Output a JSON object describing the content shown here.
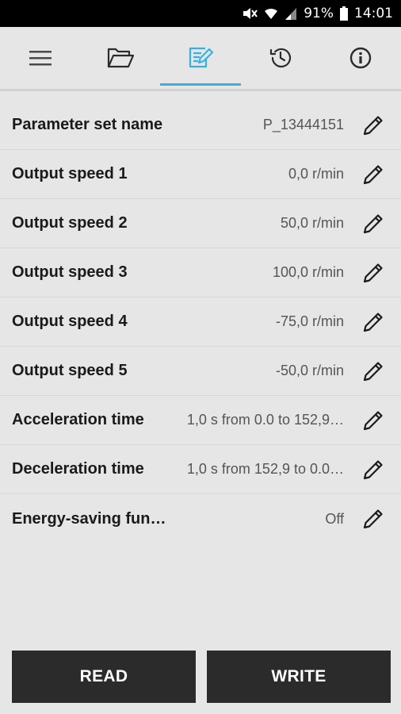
{
  "status_bar": {
    "battery_percent": "91%",
    "time": "14:01",
    "icons": [
      "mute-icon",
      "wifi-icon",
      "signal-icon",
      "battery-icon"
    ]
  },
  "tabs": [
    {
      "icon": "menu-icon",
      "active": false
    },
    {
      "icon": "folder-open-icon",
      "active": false
    },
    {
      "icon": "edit-parameters-icon",
      "active": true
    },
    {
      "icon": "history-icon",
      "active": false
    },
    {
      "icon": "info-icon",
      "active": false
    }
  ],
  "accent_color": "#3ab0e2",
  "parameters": [
    {
      "label": "Parameter set name",
      "value": "P_13444151"
    },
    {
      "label": "Output speed 1",
      "value": "0,0 r/min"
    },
    {
      "label": "Output speed 2",
      "value": "50,0 r/min"
    },
    {
      "label": "Output speed 3",
      "value": "100,0 r/min"
    },
    {
      "label": "Output speed 4",
      "value": "-75,0 r/min"
    },
    {
      "label": "Output speed 5",
      "value": "-50,0 r/min"
    },
    {
      "label": "Acceleration time",
      "value": "1,0 s from 0.0 to 152,9…"
    },
    {
      "label": "Deceleration time",
      "value": "1,0 s from 152,9 to 0.0…"
    },
    {
      "label": "Energy-saving fun…",
      "value": "Off"
    }
  ],
  "buttons": {
    "read": "READ",
    "write": "WRITE"
  }
}
